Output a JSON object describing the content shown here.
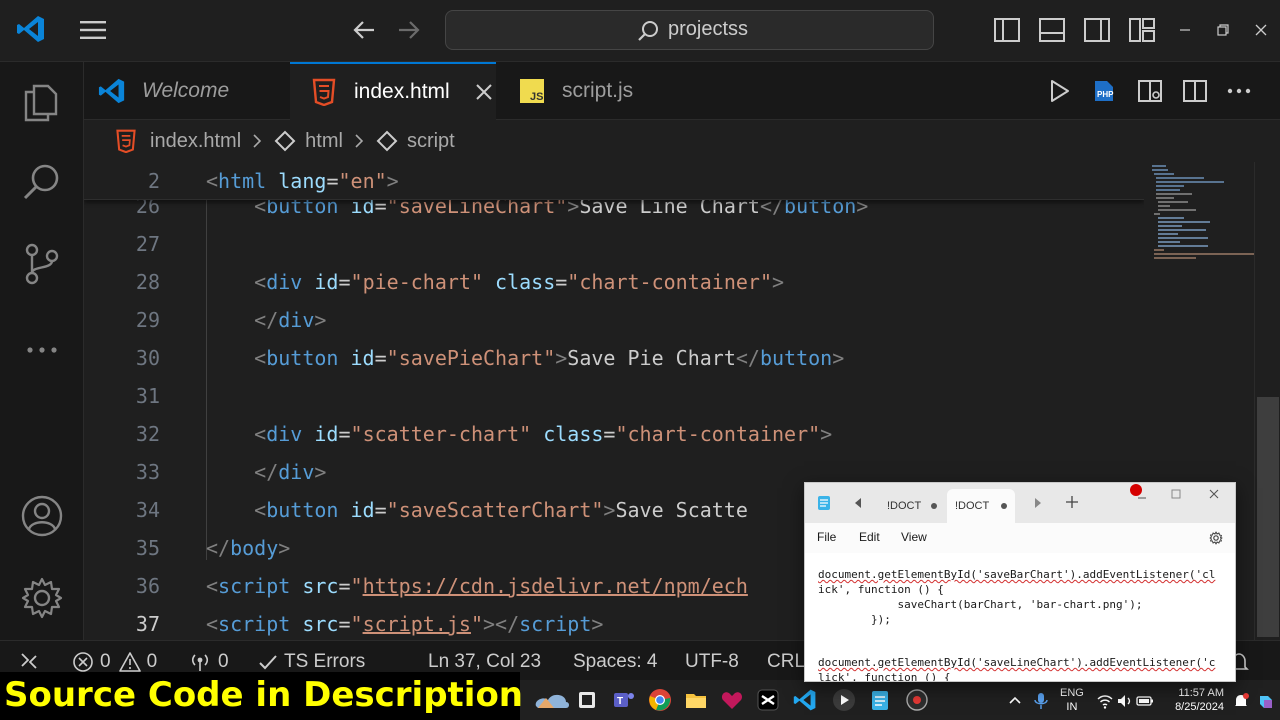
{
  "titlebar": {
    "search_text": "projectss"
  },
  "tabs": [
    {
      "label": "Welcome"
    },
    {
      "label": "index.html"
    },
    {
      "label": "script.js"
    }
  ],
  "breadcrumb": [
    "index.html",
    "html",
    "script"
  ],
  "editor": {
    "current_line": 37,
    "sticky": {
      "num": "2",
      "tokens": [
        [
          "br",
          "<"
        ],
        [
          "tag",
          "html"
        ],
        [
          "txt",
          " "
        ],
        [
          "attr",
          "lang"
        ],
        [
          "txt",
          "="
        ],
        [
          "str",
          "\"en\""
        ],
        [
          "br",
          ">"
        ]
      ]
    },
    "lines": [
      {
        "num": "26",
        "indent": 2,
        "tokens": [
          [
            "br",
            "<"
          ],
          [
            "tag",
            "button"
          ],
          [
            "txt",
            " "
          ],
          [
            "attr",
            "id"
          ],
          [
            "txt",
            "="
          ],
          [
            "str",
            "\"saveLineChart\""
          ],
          [
            "br",
            ">"
          ],
          [
            "txt",
            "Save Line Chart"
          ],
          [
            "br",
            "</"
          ],
          [
            "tag",
            "button"
          ],
          [
            "br",
            ">"
          ]
        ]
      },
      {
        "num": "27",
        "indent": 0,
        "tokens": []
      },
      {
        "num": "28",
        "indent": 2,
        "tokens": [
          [
            "br",
            "<"
          ],
          [
            "tag",
            "div"
          ],
          [
            "txt",
            " "
          ],
          [
            "attr",
            "id"
          ],
          [
            "txt",
            "="
          ],
          [
            "str",
            "\"pie-chart\""
          ],
          [
            "txt",
            " "
          ],
          [
            "attr",
            "class"
          ],
          [
            "txt",
            "="
          ],
          [
            "str",
            "\"chart-container\""
          ],
          [
            "br",
            ">"
          ]
        ]
      },
      {
        "num": "29",
        "indent": 2,
        "tokens": [
          [
            "br",
            "</"
          ],
          [
            "tag",
            "div"
          ],
          [
            "br",
            ">"
          ]
        ]
      },
      {
        "num": "30",
        "indent": 2,
        "tokens": [
          [
            "br",
            "<"
          ],
          [
            "tag",
            "button"
          ],
          [
            "txt",
            " "
          ],
          [
            "attr",
            "id"
          ],
          [
            "txt",
            "="
          ],
          [
            "str",
            "\"savePieChart\""
          ],
          [
            "br",
            ">"
          ],
          [
            "txt",
            "Save Pie Chart"
          ],
          [
            "br",
            "</"
          ],
          [
            "tag",
            "button"
          ],
          [
            "br",
            ">"
          ]
        ]
      },
      {
        "num": "31",
        "indent": 0,
        "tokens": []
      },
      {
        "num": "32",
        "indent": 2,
        "tokens": [
          [
            "br",
            "<"
          ],
          [
            "tag",
            "div"
          ],
          [
            "txt",
            " "
          ],
          [
            "attr",
            "id"
          ],
          [
            "txt",
            "="
          ],
          [
            "str",
            "\"scatter-chart\""
          ],
          [
            "txt",
            " "
          ],
          [
            "attr",
            "class"
          ],
          [
            "txt",
            "="
          ],
          [
            "str",
            "\"chart-container\""
          ],
          [
            "br",
            ">"
          ]
        ]
      },
      {
        "num": "33",
        "indent": 2,
        "tokens": [
          [
            "br",
            "</"
          ],
          [
            "tag",
            "div"
          ],
          [
            "br",
            ">"
          ]
        ]
      },
      {
        "num": "34",
        "indent": 2,
        "tokens": [
          [
            "br",
            "<"
          ],
          [
            "tag",
            "button"
          ],
          [
            "txt",
            " "
          ],
          [
            "attr",
            "id"
          ],
          [
            "txt",
            "="
          ],
          [
            "str",
            "\"saveScatterChart\""
          ],
          [
            "br",
            ">"
          ],
          [
            "txt",
            "Save Scatte"
          ]
        ]
      },
      {
        "num": "35",
        "indent": 0,
        "tokens": [
          [
            "br",
            "</"
          ],
          [
            "tag",
            "body"
          ],
          [
            "br",
            ">"
          ]
        ]
      },
      {
        "num": "36",
        "indent": 0,
        "tokens": [
          [
            "br",
            "<"
          ],
          [
            "tag",
            "script"
          ],
          [
            "txt",
            " "
          ],
          [
            "attr",
            "src"
          ],
          [
            "txt",
            "="
          ],
          [
            "str",
            "\""
          ],
          [
            "link",
            "https://cdn.jsdelivr.net/npm/ech"
          ]
        ]
      },
      {
        "num": "37",
        "indent": 0,
        "tokens": [
          [
            "br",
            "<"
          ],
          [
            "tag",
            "script"
          ],
          [
            "txt",
            " "
          ],
          [
            "attr",
            "src"
          ],
          [
            "txt",
            "="
          ],
          [
            "str",
            "\""
          ],
          [
            "link",
            "script.js"
          ],
          [
            "str",
            "\""
          ],
          [
            "br",
            "></"
          ],
          [
            "tag",
            "script"
          ],
          [
            "br",
            ">"
          ]
        ]
      }
    ]
  },
  "statusbar": {
    "errors": "0",
    "warnings": "0",
    "ports": "0",
    "ts_errors": "TS Errors",
    "position": "Ln 37, Col 23",
    "spaces": "Spaces: 4",
    "encoding": "UTF-8",
    "eol": "CRL"
  },
  "banner": {
    "text": "Source Code in  Description"
  },
  "notepad": {
    "tabs": [
      "!DOCT",
      "!DOCT"
    ],
    "menu": [
      "File",
      "Edit",
      "View"
    ],
    "lines": [
      "document.getElementById('saveBarChart').addEventListener('cl",
      "ick', function () {",
      "            saveChart(barChart, 'bar-chart.png');",
      "        });",
      "",
      "document.getElementById('saveLineChart').addEventListener('c",
      "lick', function () {"
    ]
  },
  "taskbar": {
    "lang_top": "ENG",
    "lang_bottom": "IN",
    "time": "11:57 AM",
    "date": "8/25/2024"
  },
  "colors": {
    "accent": "#0078d4",
    "banner_text": "#ffff00",
    "html_icon": "#e44d26",
    "js_icon": "#f0db4f"
  }
}
